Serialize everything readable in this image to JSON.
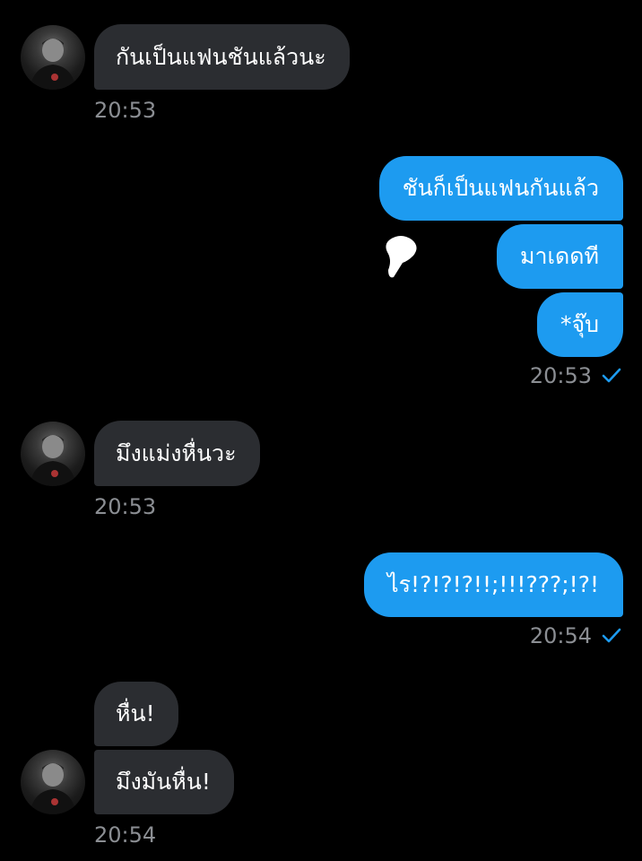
{
  "conversation": {
    "messages": [
      {
        "text": "กันเป็นแฟนชันแล้วนะ"
      },
      {
        "text": "ชันก็เป็นแฟนกันแล้ว"
      },
      {
        "text": "มาเดดที"
      },
      {
        "text": "*จุ๊บ"
      },
      {
        "text": "มึงแม่งหื่นวะ"
      },
      {
        "text": "ไร!?!?!?!!;!!!???;!?!"
      },
      {
        "text": "หื่น!"
      },
      {
        "text": "มึงมันหื่น!"
      }
    ],
    "timestamps": [
      "20:53",
      "20:53",
      "20:53",
      "20:54",
      "20:54"
    ]
  },
  "colors": {
    "background": "#000000",
    "incoming_bubble": "#2b2d31",
    "outgoing_bubble": "#1d9bf0",
    "timestamp": "#8b8e93",
    "read_check": "#1d9bf0"
  },
  "icons": {
    "avatar": "user-avatar",
    "read_receipt": "checkmark-icon"
  }
}
